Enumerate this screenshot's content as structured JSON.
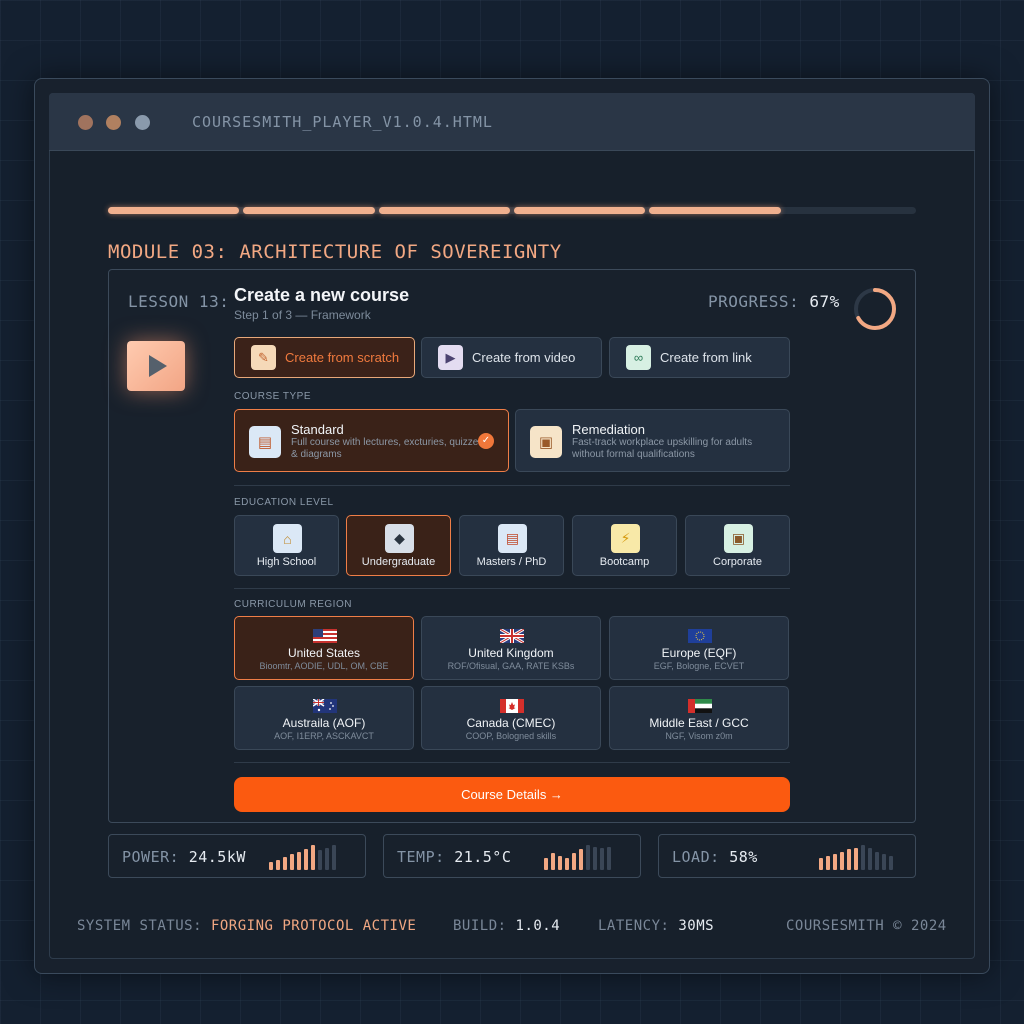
{
  "window": {
    "title": "COURSESMITH_PLAYER_V1.0.4.HTML"
  },
  "module": {
    "title": "MODULE 03: ARCHITECTURE OF SOVEREIGNTY",
    "segments_completed": 5,
    "segments_total": 6
  },
  "lesson": {
    "number_label": "LESSON 13:",
    "title": "Create a new course",
    "step": "Step 1 of 3 — Framework",
    "progress_label": "PROGRESS:",
    "progress_value": "67%",
    "progress_fraction": 0.67
  },
  "sources": [
    {
      "label": "Create from scratch",
      "icon": "pencil-icon",
      "selected": true
    },
    {
      "label": "Create from video",
      "icon": "video-camera-icon",
      "selected": false
    },
    {
      "label": "Create from link",
      "icon": "link-icon",
      "selected": false
    }
  ],
  "course_type": {
    "label": "COURSE TYPE",
    "options": [
      {
        "name": "Standard",
        "desc": "Full course with lectures, excturies, quizzes & diagrams",
        "icon": "books-icon",
        "selected": true
      },
      {
        "name": "Remediation",
        "desc": "Fast-track workplace upskilling for adults without formal qualifications",
        "icon": "briefcase-icon",
        "selected": false
      }
    ]
  },
  "education_level": {
    "label": "EDUCATION LEVEL",
    "options": [
      {
        "label": "High School",
        "icon": "school-icon",
        "selected": false
      },
      {
        "label": "Undergraduate",
        "icon": "graduation-cap-icon",
        "selected": true
      },
      {
        "label": "Masters / PhD",
        "icon": "books-icon",
        "selected": false
      },
      {
        "label": "Bootcamp",
        "icon": "lightning-icon",
        "selected": false
      },
      {
        "label": "Corporate",
        "icon": "briefcase-icon",
        "selected": false
      }
    ]
  },
  "curriculum_region": {
    "label": "CURRICULUM REGION",
    "options": [
      {
        "name": "United States",
        "sub": "Bioomtr, AODIE, UDL, OM, CBE",
        "flag": "us-flag-icon",
        "selected": true
      },
      {
        "name": "United Kingdom",
        "sub": "ROF/Ofisual, GAA, RATE KSBs",
        "flag": "uk-flag-icon",
        "selected": false
      },
      {
        "name": "Europe (EQF)",
        "sub": "EGF, Bologne, ECVET",
        "flag": "eu-flag-icon",
        "selected": false
      },
      {
        "name": "Austraila (AOF)",
        "sub": "AOF, I1ERP, ASCKAVCT",
        "flag": "australia-flag-icon",
        "selected": false
      },
      {
        "name": "Canada (CMEC)",
        "sub": "COOP, Bologned skills",
        "flag": "canada-flag-icon",
        "selected": false
      },
      {
        "name": "Middle East / GCC",
        "sub": "NGF, Visom z0m",
        "flag": "uae-flag-icon",
        "selected": false
      }
    ]
  },
  "cta": {
    "label": "Course Details →"
  },
  "metrics": [
    {
      "label": "POWER:",
      "value": "24.5kW",
      "levels": [
        0.3,
        0.4,
        0.5,
        0.6,
        0.7,
        0.8,
        0.95,
        0.75,
        0.85,
        0.95
      ],
      "lit": 7
    },
    {
      "label": "TEMP:",
      "value": "21.5°C",
      "levels": [
        0.45,
        0.65,
        0.55,
        0.45,
        0.65,
        0.8,
        0.95,
        0.9,
        0.85,
        0.9
      ],
      "lit": 6
    },
    {
      "label": "LOAD:",
      "value": "58%",
      "levels": [
        0.45,
        0.55,
        0.6,
        0.7,
        0.8,
        0.85,
        0.95,
        0.85,
        0.7,
        0.6,
        0.55
      ],
      "lit": 6
    }
  ],
  "status": {
    "system_label": "SYSTEM STATUS:",
    "system_value": "FORGING PROTOCOL ACTIVE",
    "build_label": "BUILD:",
    "build_value": "1.0.4",
    "latency_label": "LATENCY:",
    "latency_value": "30MS",
    "copyright": "COURSESMITH © 2024"
  },
  "colors": {
    "accent": "#f07a3e",
    "accent_soft": "#f2a883",
    "cta": "#fb5a10",
    "bar_lit": "#f2a883",
    "bar_dim": "#3a4656"
  }
}
